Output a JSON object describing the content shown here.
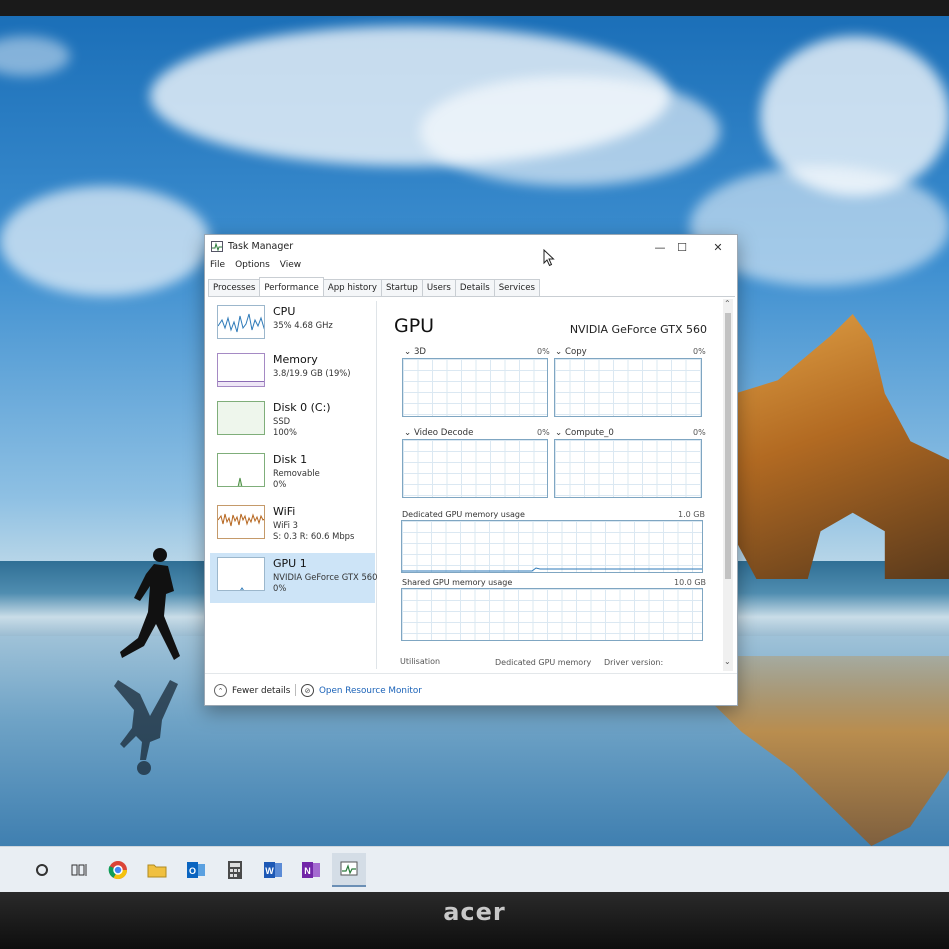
{
  "brand": "acer",
  "window": {
    "title": "Task Manager",
    "buttons": {
      "minimize": "—",
      "maximize": "☐",
      "close": "✕"
    }
  },
  "menu": [
    "File",
    "Options",
    "View"
  ],
  "tabs": [
    "Processes",
    "Performance",
    "App history",
    "Startup",
    "Users",
    "Details",
    "Services"
  ],
  "active_tab": "Performance",
  "devices": [
    {
      "name": "CPU",
      "sub1": "35% 4.68 GHz",
      "sub2": ""
    },
    {
      "name": "Memory",
      "sub1": "3.8/19.9 GB (19%)",
      "sub2": ""
    },
    {
      "name": "Disk 0 (C:)",
      "sub1": "SSD",
      "sub2": "100%"
    },
    {
      "name": "Disk 1",
      "sub1": "Removable",
      "sub2": "0%"
    },
    {
      "name": "WiFi",
      "sub1": "WiFi 3",
      "sub2": "S: 0.3  R: 60.6 Mbps"
    },
    {
      "name": "GPU 1",
      "sub1": "NVIDIA GeForce GTX 560",
      "sub2": "0%"
    }
  ],
  "selected_device": "GPU 1",
  "gpu_pane": {
    "title": "GPU",
    "model": "NVIDIA GeForce GTX 560",
    "engines": [
      {
        "label": "3D",
        "pct": "0%"
      },
      {
        "label": "Copy",
        "pct": "0%"
      },
      {
        "label": "Video Decode",
        "pct": "0%"
      },
      {
        "label": "Compute_0",
        "pct": "0%"
      }
    ],
    "dedicated": {
      "label": "Dedicated GPU memory usage",
      "max": "1.0 GB"
    },
    "shared": {
      "label": "Shared GPU memory usage",
      "max": "10.0 GB"
    },
    "stats": {
      "utilisation": "Utilisation",
      "dedicated_memory": "Dedicated GPU memory",
      "driver_version": "Driver version:"
    }
  },
  "footer": {
    "fewer_details": "Fewer details",
    "open_monitor": "Open Resource Monitor"
  },
  "taskbar": [
    "cortana-icon",
    "task-view-icon",
    "chrome-icon",
    "file-explorer-icon",
    "outlook-icon",
    "calculator-icon",
    "word-icon",
    "onenote-icon",
    "task-manager-icon"
  ],
  "colors": {
    "graph_border": "#7fa6c2",
    "selected_bg": "#cde4f7",
    "link": "#1a62b8",
    "desktop_sky": "#1b6fb8"
  }
}
